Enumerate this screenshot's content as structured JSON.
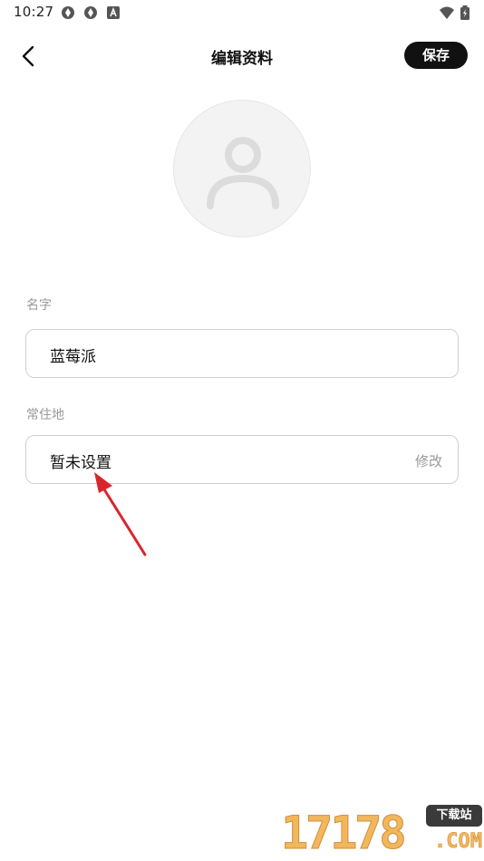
{
  "status_bar": {
    "time": "10:27",
    "left_icons": [
      "sync-icon",
      "sync-icon",
      "notification-a-icon"
    ],
    "right_icons": [
      "wifi-icon",
      "battery-charging-icon"
    ]
  },
  "header": {
    "back_icon": "chevron-left-icon",
    "title": "编辑资料",
    "save_label": "保存"
  },
  "avatar": {
    "icon": "default-user-avatar-icon"
  },
  "form": {
    "name": {
      "label": "名字",
      "value": "蓝莓派"
    },
    "residence": {
      "label": "常住地",
      "value": "暂未设置",
      "action": "修改"
    }
  },
  "annotation": {
    "arrow_color": "#d9262c"
  },
  "watermark": {
    "digits": "17178",
    "badge": "下载站",
    "suffix": ".COM"
  },
  "colors": {
    "primary_button": "#111111",
    "label_gray": "#999999",
    "border_gray": "#cfcfcf"
  }
}
